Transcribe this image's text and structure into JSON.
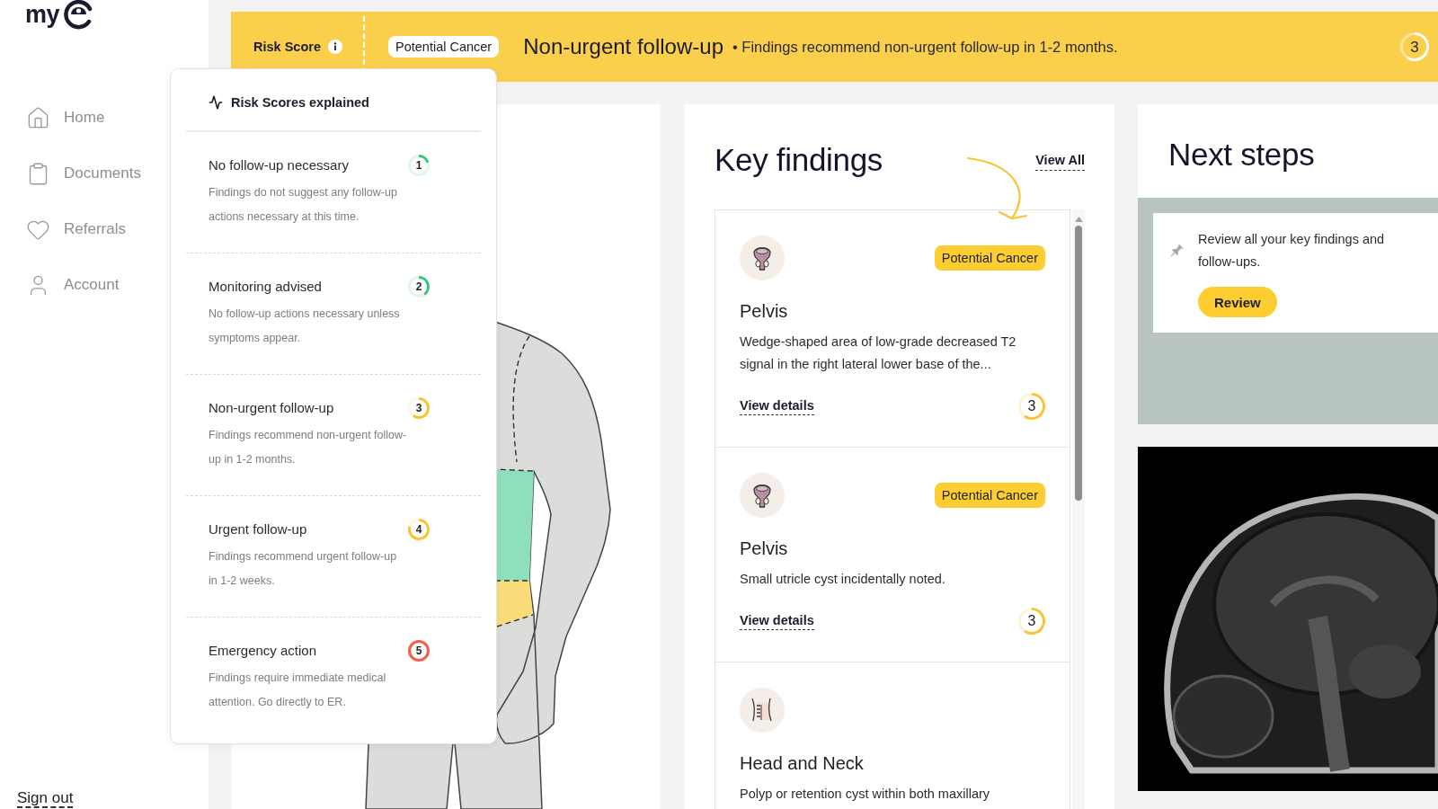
{
  "sidebar": {
    "logo": "my",
    "nav": [
      {
        "label": "Home"
      },
      {
        "label": "Documents"
      },
      {
        "label": "Referrals"
      },
      {
        "label": "Account"
      }
    ],
    "sign_out": "Sign out"
  },
  "risk_banner": {
    "label": "Risk Score",
    "tag": "Potential Cancer",
    "title": "Non-urgent follow-up",
    "summary": "• Findings recommend non-urgent follow-up in 1-2 months.",
    "score": "3"
  },
  "risk_scores_popover": {
    "title": "Risk Scores explained",
    "items": [
      {
        "title": "No follow-up necessary",
        "description": "Findings do not suggest any follow-up actions necessary at this time.",
        "score": "1",
        "color": "#34c77b"
      },
      {
        "title": "Monitoring advised",
        "description": "No follow-up actions necessary unless symptoms appear.",
        "score": "2",
        "color": "#34c77b"
      },
      {
        "title": "Non-urgent follow-up",
        "description": "Findings recommend non-urgent follow-up in 1-2 months.",
        "score": "3",
        "color": "#f7c531"
      },
      {
        "title": "Urgent follow-up",
        "description": "Findings recommend urgent follow-up in 1-2 weeks.",
        "score": "4",
        "color": "#f7c531"
      },
      {
        "title": "Emergency action",
        "description": "Findings require immediate medical attention. Go directly to ER.",
        "score": "5",
        "color": "#f2604a"
      }
    ]
  },
  "key_findings": {
    "title": "Key findings",
    "view_all": "View All",
    "findings": [
      {
        "kind": "pelvis",
        "tag": "Potential Cancer",
        "region": "Pelvis",
        "description": "Wedge-shaped area of low-grade decreased T2 signal in the right lateral lower base of the...",
        "link": "View details",
        "score": "3"
      },
      {
        "kind": "pelvis",
        "tag": "Potential Cancer",
        "region": "Pelvis",
        "description": "Small utricle cyst incidentally noted.",
        "link": "View details",
        "score": "3"
      },
      {
        "kind": "neck",
        "region": "Head and Neck",
        "description": "Polyp or retention cyst within both maxillary"
      }
    ]
  },
  "next_steps": {
    "title": "Next steps",
    "tasks": [
      {
        "text": "Review all your key findings and follow-ups.",
        "button": "Review"
      }
    ]
  }
}
